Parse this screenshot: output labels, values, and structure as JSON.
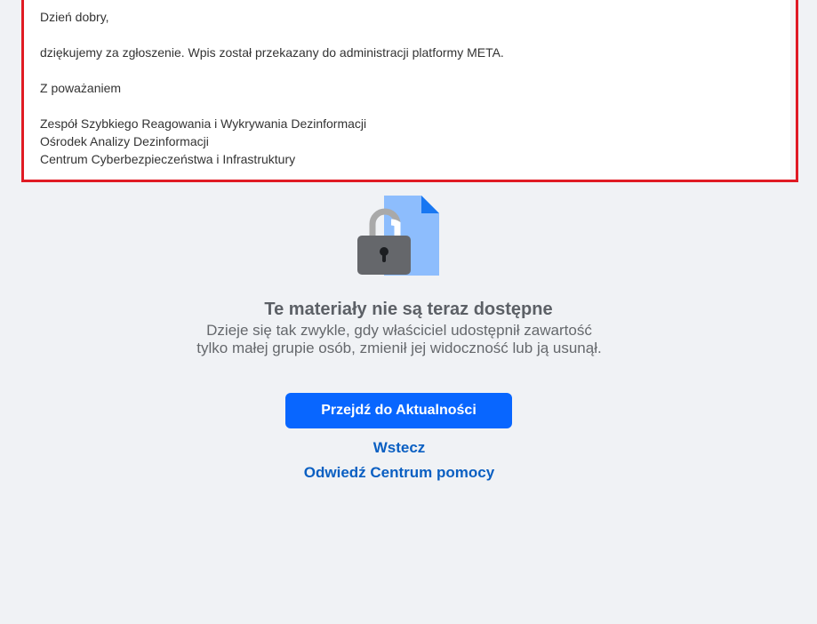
{
  "email": {
    "greeting": "Dzień dobry,",
    "body": "dziękujemy za zgłoszenie. Wpis został przekazany do administracji platformy META.",
    "closing": "Z poważaniem",
    "signature": [
      "Zespół Szybkiego Reagowania i Wykrywania Dezinformacji",
      "Ośrodek Analizy Dezinformacji",
      "Centrum Cyberbezpieczeństwa i Infrastruktury"
    ]
  },
  "notice": {
    "title": "Te materiały nie są teraz dostępne",
    "description": "Dzieje się tak zwykle, gdy właściciel udostępnił zawartość tylko małej grupie osób, zmienił jej widoczność lub ją usunął.",
    "icon": "locked-document-icon"
  },
  "actions": {
    "primary_label": "Przejdź do Aktualności",
    "back_label": "Wstecz",
    "help_label": "Odwiedź Centrum pomocy"
  },
  "colors": {
    "highlight_border": "#e01b24",
    "primary_button": "#0866ff",
    "link": "#0a5fc2",
    "background": "#f0f2f5"
  }
}
